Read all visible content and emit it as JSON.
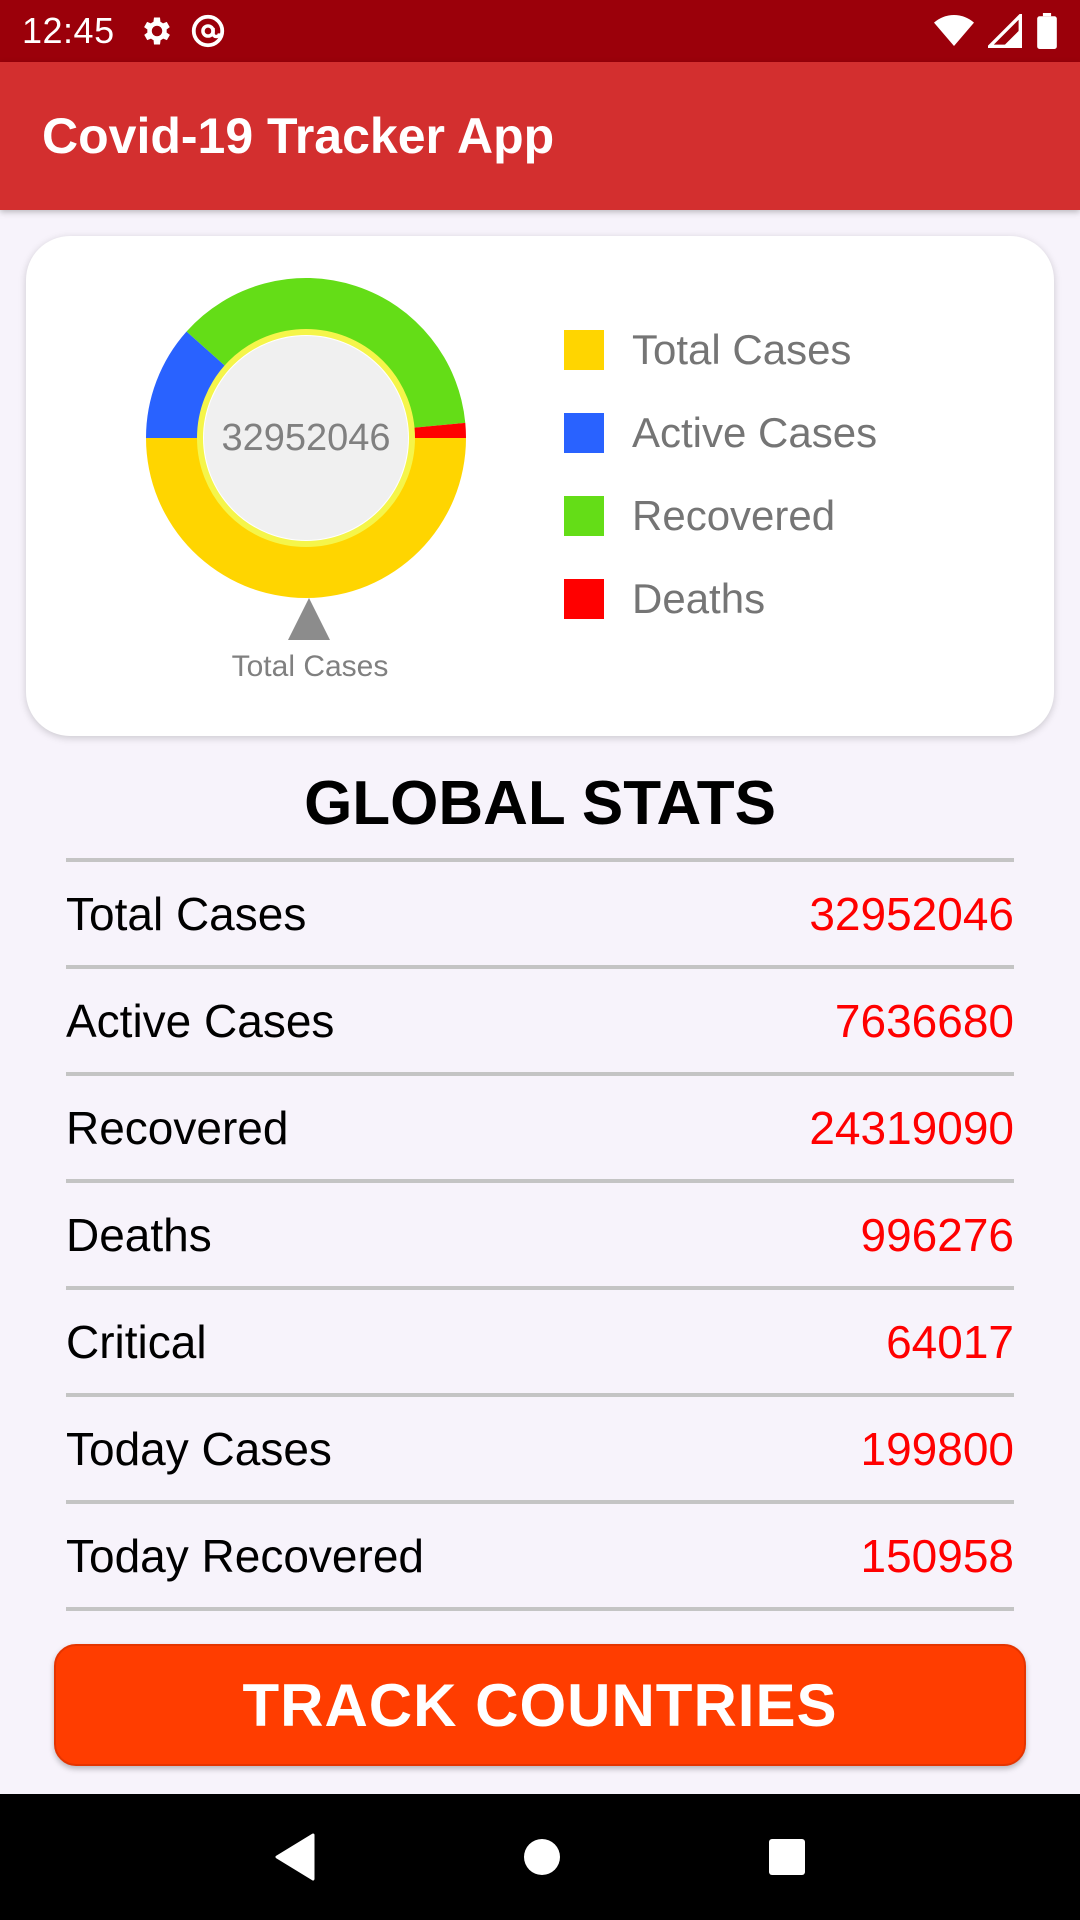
{
  "status_bar": {
    "time": "12:45",
    "left_icons": [
      "gear-icon",
      "at-sign-icon"
    ],
    "right_icons": [
      "wifi-icon",
      "signal-icon",
      "battery-icon"
    ]
  },
  "app_bar": {
    "title": "Covid-19 Tracker App",
    "color": "#d32f2f"
  },
  "chart_card": {
    "center_text": "32952046",
    "pointer_label": "Total Cases",
    "legend": [
      {
        "label": "Total Cases",
        "color": "#ffd500"
      },
      {
        "label": "Active Cases",
        "color": "#2962ff"
      },
      {
        "label": "Recovered",
        "color": "#64dd17"
      },
      {
        "label": "Deaths",
        "color": "#ff0000"
      }
    ]
  },
  "chart_data": {
    "type": "pie",
    "categories": [
      "Total Cases",
      "Active Cases",
      "Recovered",
      "Deaths"
    ],
    "values": [
      32952046,
      7636680,
      24319090,
      996276
    ],
    "colors": [
      "#ffd500",
      "#2962ff",
      "#64dd17",
      "#ff0000"
    ],
    "center_label": "32952046",
    "legend_position": "right"
  },
  "stats": {
    "title": "GLOBAL STATS",
    "rows": [
      {
        "label": "Total Cases",
        "value": "32952046"
      },
      {
        "label": "Active Cases",
        "value": "7636680"
      },
      {
        "label": "Recovered",
        "value": "24319090"
      },
      {
        "label": "Deaths",
        "value": "996276"
      },
      {
        "label": "Critical",
        "value": "64017"
      },
      {
        "label": "Today Cases",
        "value": "199800"
      },
      {
        "label": "Today Recovered",
        "value": "150958"
      }
    ]
  },
  "button": {
    "label": "TRACK COUNTRIES",
    "color": "#ff3d00"
  },
  "nav_bar": {
    "icons": [
      "back-icon",
      "home-icon",
      "recents-icon"
    ]
  }
}
